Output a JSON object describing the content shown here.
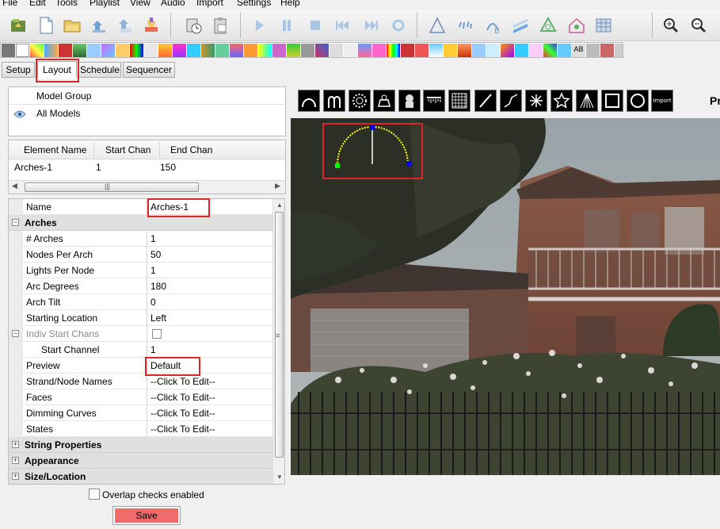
{
  "menu": [
    "File",
    "Edit",
    "Tools",
    "Playlist",
    "View",
    "Audio",
    "Import",
    "Settings",
    "Help"
  ],
  "toolbar_icons": [
    "open-folder-icon",
    "new-file-icon",
    "folder-icon",
    "save-icon",
    "save-as-icon",
    "paint-icon",
    "clock-icon",
    "clipboard-icon",
    "play-icon",
    "pause-icon",
    "stop-icon",
    "rewind-icon",
    "fast-forward-icon",
    "repeat-icon",
    "triangle-icon",
    "sparkle-icon",
    "bezier-icon",
    "bars-icon",
    "tree-icon",
    "house-icon",
    "grid-icon",
    "zoom-in-icon",
    "zoom-out-icon"
  ],
  "tabs": {
    "setup": "Setup",
    "layout": "Layout",
    "schedule": "Schedule",
    "sequencer": "Sequencer"
  },
  "model_group": {
    "header": "Model Group",
    "row": "All Models"
  },
  "element_table": {
    "columns": [
      "Element Name",
      "Start Chan",
      "End Chan"
    ],
    "rows": [
      {
        "name": "Arches-1",
        "start": "1",
        "end": "150"
      }
    ]
  },
  "properties": {
    "name_label": "Name",
    "name_value": "Arches-1",
    "category_arches": "Arches",
    "rows": [
      {
        "label": "# Arches",
        "value": "1"
      },
      {
        "label": "Nodes Per Arch",
        "value": "50"
      },
      {
        "label": "Lights Per Node",
        "value": "1"
      },
      {
        "label": "Arc Degrees",
        "value": "180"
      },
      {
        "label": "Arch Tilt",
        "value": "0"
      },
      {
        "label": "Starting Location",
        "value": "Left"
      }
    ],
    "indiv_start_chans": "Indiv Start Chans",
    "start_channel_label": "Start Channel",
    "start_channel_value": "1",
    "preview_label": "Preview",
    "preview_value": "Default",
    "strand_names_label": "Strand/Node Names",
    "faces_label": "Faces",
    "dimming_label": "Dimming Curves",
    "states_label": "States",
    "click_to_edit": "--Click To Edit--",
    "category_string": "String Properties",
    "category_appearance": "Appearance",
    "category_size": "Size/Location"
  },
  "overlap_checks": "Overlap checks enabled",
  "save_button": "Save",
  "model_buttons": [
    "arch-icon",
    "candy-cane-icon",
    "circle-dots-icon",
    "custom-icon",
    "star-icon",
    "icicle-icon",
    "matrix-icon",
    "line-icon",
    "polyline-icon",
    "spinner-icon",
    "star-outline-icon",
    "tree-icon",
    "square-icon",
    "circle-icon",
    "import-icon"
  ],
  "import_label": "Import",
  "panel_title_partial": "Pr",
  "colors": {
    "highlight_red": "#d9262b",
    "save_red": "#f26b6b",
    "arch_yellow": "#ffff00"
  }
}
